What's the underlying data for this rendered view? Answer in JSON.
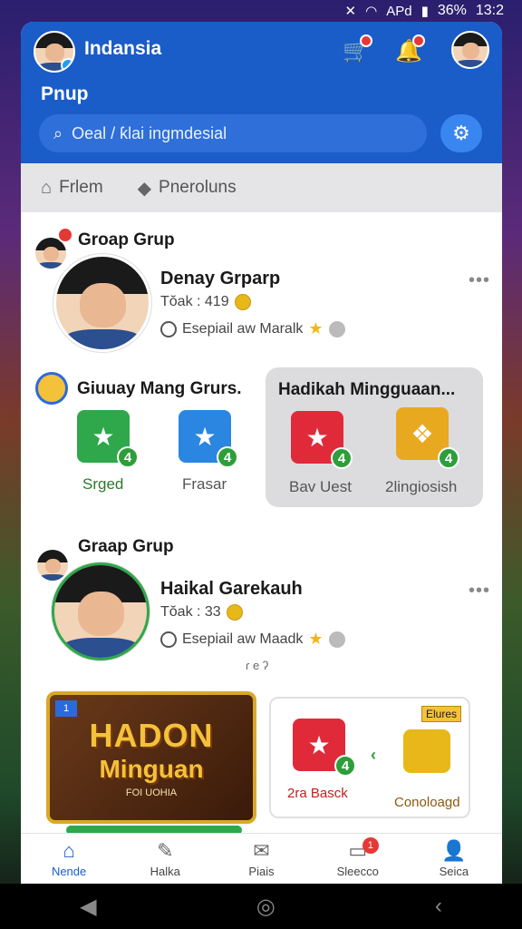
{
  "status_bar": {
    "battery": "36%",
    "time": "13:2",
    "network": "APd"
  },
  "header": {
    "title": "Indansia",
    "subtitle": "Pnup",
    "search_placeholder": "Oeal / ƙlai ingmdesial"
  },
  "tabs": [
    {
      "label": "Frlem",
      "icon": "home-icon"
    },
    {
      "label": "Pneroluns",
      "icon": "tag-icon"
    }
  ],
  "group1": {
    "title": "Groap Grup",
    "person": {
      "name": "Denay Grparp",
      "meta1": "Tŏak : 419",
      "meta2": "Esepiail aw Maralk"
    }
  },
  "rewards": {
    "left_title": "Giuuay Mang Grurs.",
    "left_items": [
      {
        "label": "Srged",
        "color": "#2ea84a",
        "plus": "4"
      },
      {
        "label": "Frasar",
        "color": "#2a86e0",
        "plus": "4"
      }
    ],
    "card_title": "Hadikah Mingguaan...",
    "card_items": [
      {
        "label": "Bav Uest",
        "color": "#e02a3a",
        "plus": "4"
      },
      {
        "label": "2lingiosish",
        "color": "#e8a820",
        "plus": "4"
      }
    ]
  },
  "group2": {
    "title": "Graap Grup",
    "person": {
      "name": "Haikal Garekauh",
      "meta1": "Tŏak : 33",
      "meta2": "Esepiail aw Maadk"
    },
    "small_text": "ɾ e ʔ"
  },
  "promo": {
    "left_line1": "HADON",
    "left_line2": "Minguan",
    "left_line3": "FOI UOHIA",
    "left_ribbon": "1",
    "right_label1": "2ra Basck",
    "right_label2": "Conoloagd",
    "right_tag": "Elures",
    "right_plus": "4"
  },
  "bottom_nav": [
    {
      "label": "Nende",
      "icon": "home-icon",
      "active": true
    },
    {
      "label": "Halka",
      "icon": "pencil-icon",
      "active": false
    },
    {
      "label": "Piais",
      "icon": "mail-icon",
      "active": false
    },
    {
      "label": "Sleecco",
      "icon": "sofa-icon",
      "active": false,
      "badge": "1"
    },
    {
      "label": "Seica",
      "icon": "person-icon",
      "active": false
    }
  ],
  "header_badge": "1"
}
